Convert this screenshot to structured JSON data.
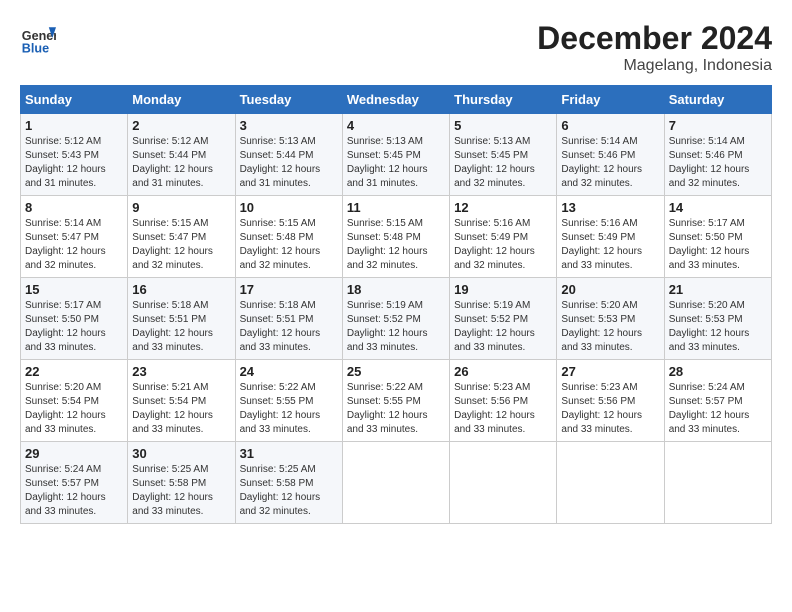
{
  "header": {
    "logo_general": "General",
    "logo_blue": "Blue",
    "title": "December 2024",
    "location": "Magelang, Indonesia"
  },
  "calendar": {
    "columns": [
      "Sunday",
      "Monday",
      "Tuesday",
      "Wednesday",
      "Thursday",
      "Friday",
      "Saturday"
    ],
    "weeks": [
      [
        {
          "day": "",
          "detail": ""
        },
        {
          "day": "2",
          "detail": "Sunrise: 5:12 AM\nSunset: 5:44 PM\nDaylight: 12 hours\nand 31 minutes."
        },
        {
          "day": "3",
          "detail": "Sunrise: 5:13 AM\nSunset: 5:44 PM\nDaylight: 12 hours\nand 31 minutes."
        },
        {
          "day": "4",
          "detail": "Sunrise: 5:13 AM\nSunset: 5:45 PM\nDaylight: 12 hours\nand 31 minutes."
        },
        {
          "day": "5",
          "detail": "Sunrise: 5:13 AM\nSunset: 5:45 PM\nDaylight: 12 hours\nand 32 minutes."
        },
        {
          "day": "6",
          "detail": "Sunrise: 5:14 AM\nSunset: 5:46 PM\nDaylight: 12 hours\nand 32 minutes."
        },
        {
          "day": "7",
          "detail": "Sunrise: 5:14 AM\nSunset: 5:46 PM\nDaylight: 12 hours\nand 32 minutes."
        }
      ],
      [
        {
          "day": "1",
          "detail": "Sunrise: 5:12 AM\nSunset: 5:43 PM\nDaylight: 12 hours\nand 31 minutes."
        },
        {
          "day": "",
          "detail": ""
        },
        {
          "day": "",
          "detail": ""
        },
        {
          "day": "",
          "detail": ""
        },
        {
          "day": "",
          "detail": ""
        },
        {
          "day": "",
          "detail": ""
        },
        {
          "day": "",
          "detail": ""
        }
      ],
      [
        {
          "day": "8",
          "detail": "Sunrise: 5:14 AM\nSunset: 5:47 PM\nDaylight: 12 hours\nand 32 minutes."
        },
        {
          "day": "9",
          "detail": "Sunrise: 5:15 AM\nSunset: 5:47 PM\nDaylight: 12 hours\nand 32 minutes."
        },
        {
          "day": "10",
          "detail": "Sunrise: 5:15 AM\nSunset: 5:48 PM\nDaylight: 12 hours\nand 32 minutes."
        },
        {
          "day": "11",
          "detail": "Sunrise: 5:15 AM\nSunset: 5:48 PM\nDaylight: 12 hours\nand 32 minutes."
        },
        {
          "day": "12",
          "detail": "Sunrise: 5:16 AM\nSunset: 5:49 PM\nDaylight: 12 hours\nand 32 minutes."
        },
        {
          "day": "13",
          "detail": "Sunrise: 5:16 AM\nSunset: 5:49 PM\nDaylight: 12 hours\nand 33 minutes."
        },
        {
          "day": "14",
          "detail": "Sunrise: 5:17 AM\nSunset: 5:50 PM\nDaylight: 12 hours\nand 33 minutes."
        }
      ],
      [
        {
          "day": "15",
          "detail": "Sunrise: 5:17 AM\nSunset: 5:50 PM\nDaylight: 12 hours\nand 33 minutes."
        },
        {
          "day": "16",
          "detail": "Sunrise: 5:18 AM\nSunset: 5:51 PM\nDaylight: 12 hours\nand 33 minutes."
        },
        {
          "day": "17",
          "detail": "Sunrise: 5:18 AM\nSunset: 5:51 PM\nDaylight: 12 hours\nand 33 minutes."
        },
        {
          "day": "18",
          "detail": "Sunrise: 5:19 AM\nSunset: 5:52 PM\nDaylight: 12 hours\nand 33 minutes."
        },
        {
          "day": "19",
          "detail": "Sunrise: 5:19 AM\nSunset: 5:52 PM\nDaylight: 12 hours\nand 33 minutes."
        },
        {
          "day": "20",
          "detail": "Sunrise: 5:20 AM\nSunset: 5:53 PM\nDaylight: 12 hours\nand 33 minutes."
        },
        {
          "day": "21",
          "detail": "Sunrise: 5:20 AM\nSunset: 5:53 PM\nDaylight: 12 hours\nand 33 minutes."
        }
      ],
      [
        {
          "day": "22",
          "detail": "Sunrise: 5:20 AM\nSunset: 5:54 PM\nDaylight: 12 hours\nand 33 minutes."
        },
        {
          "day": "23",
          "detail": "Sunrise: 5:21 AM\nSunset: 5:54 PM\nDaylight: 12 hours\nand 33 minutes."
        },
        {
          "day": "24",
          "detail": "Sunrise: 5:22 AM\nSunset: 5:55 PM\nDaylight: 12 hours\nand 33 minutes."
        },
        {
          "day": "25",
          "detail": "Sunrise: 5:22 AM\nSunset: 5:55 PM\nDaylight: 12 hours\nand 33 minutes."
        },
        {
          "day": "26",
          "detail": "Sunrise: 5:23 AM\nSunset: 5:56 PM\nDaylight: 12 hours\nand 33 minutes."
        },
        {
          "day": "27",
          "detail": "Sunrise: 5:23 AM\nSunset: 5:56 PM\nDaylight: 12 hours\nand 33 minutes."
        },
        {
          "day": "28",
          "detail": "Sunrise: 5:24 AM\nSunset: 5:57 PM\nDaylight: 12 hours\nand 33 minutes."
        }
      ],
      [
        {
          "day": "29",
          "detail": "Sunrise: 5:24 AM\nSunset: 5:57 PM\nDaylight: 12 hours\nand 33 minutes."
        },
        {
          "day": "30",
          "detail": "Sunrise: 5:25 AM\nSunset: 5:58 PM\nDaylight: 12 hours\nand 33 minutes."
        },
        {
          "day": "31",
          "detail": "Sunrise: 5:25 AM\nSunset: 5:58 PM\nDaylight: 12 hours\nand 32 minutes."
        },
        {
          "day": "",
          "detail": ""
        },
        {
          "day": "",
          "detail": ""
        },
        {
          "day": "",
          "detail": ""
        },
        {
          "day": "",
          "detail": ""
        }
      ]
    ]
  }
}
